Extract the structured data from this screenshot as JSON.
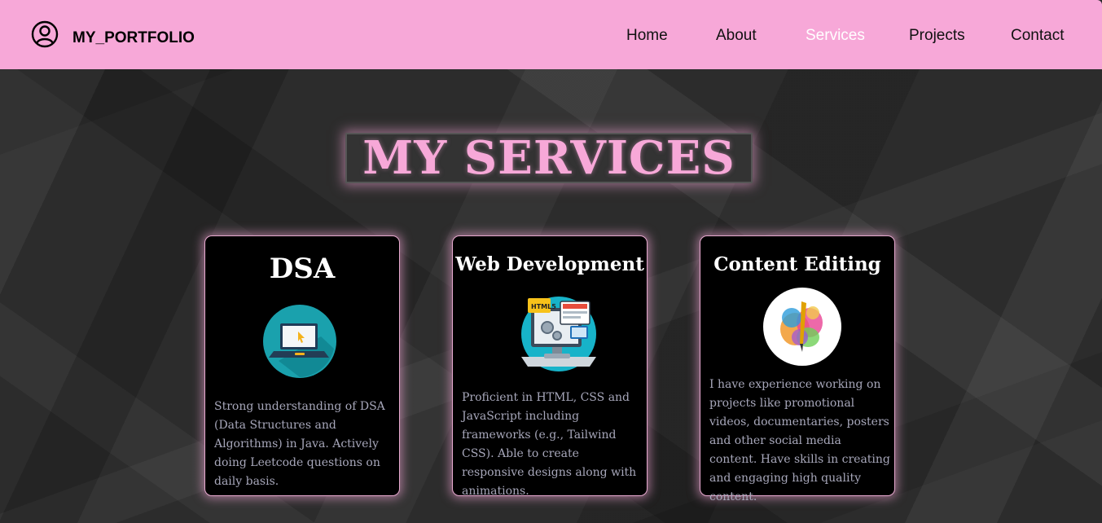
{
  "header": {
    "logo_icon": "user-circle-icon",
    "logo_text": "MY_PORTFOLIO",
    "nav": [
      {
        "label": "Home"
      },
      {
        "label": "About"
      },
      {
        "label": "Services",
        "active": true
      },
      {
        "label": "Projects"
      },
      {
        "label": "Contact"
      }
    ]
  },
  "colors": {
    "accent": "#f7a8d8",
    "background": "#2c2c2c",
    "card": "#000000",
    "card_text": "#a7a7ba"
  },
  "main": {
    "title": "MY SERVICES",
    "cards": [
      {
        "title": "DSA",
        "icon": "laptop-icon",
        "description": "Strong understanding of DSA (Data Structures and Algorithms) in Java. Actively doing Leetcode questions on daily basis."
      },
      {
        "title": "Web Development",
        "icon": "web-development-icon",
        "description": "Proficient in HTML, CSS and JavaScript including frameworks (e.g., Tailwind CSS). Able to create responsive designs along with animations."
      },
      {
        "title": "Content Editing",
        "icon": "paint-brush-icon",
        "description": "I have experience working on projects like promotional videos, documentaries, posters and other social media content. Have skills in creating and engaging high quality content."
      }
    ]
  }
}
